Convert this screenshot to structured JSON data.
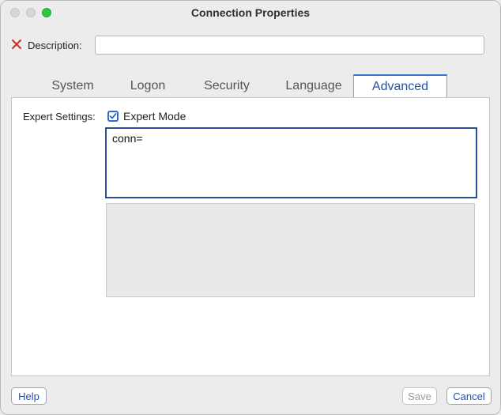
{
  "window": {
    "title": "Connection Properties",
    "controls": [
      "close",
      "minimize",
      "zoom"
    ]
  },
  "description": {
    "label": "Description:",
    "value": "",
    "icon": "error-x-icon",
    "icon_color": "#c0392b"
  },
  "tabs": [
    {
      "label": "System",
      "active": false
    },
    {
      "label": "Logon",
      "active": false
    },
    {
      "label": "Security",
      "active": false
    },
    {
      "label": "Language",
      "active": false
    },
    {
      "label": "Advanced",
      "active": true
    }
  ],
  "advanced": {
    "expert_settings_label": "Expert Settings:",
    "expert_mode_label": "Expert Mode",
    "expert_mode_checked": true,
    "expert_text": "conn="
  },
  "buttons": {
    "help": "Help",
    "save": "Save",
    "cancel": "Cancel"
  },
  "colors": {
    "accent": "#2e6bd1",
    "active_tab_text": "#2350a8",
    "zoom_button": "#2ec840",
    "disabled_text": "#9a9a9a"
  }
}
